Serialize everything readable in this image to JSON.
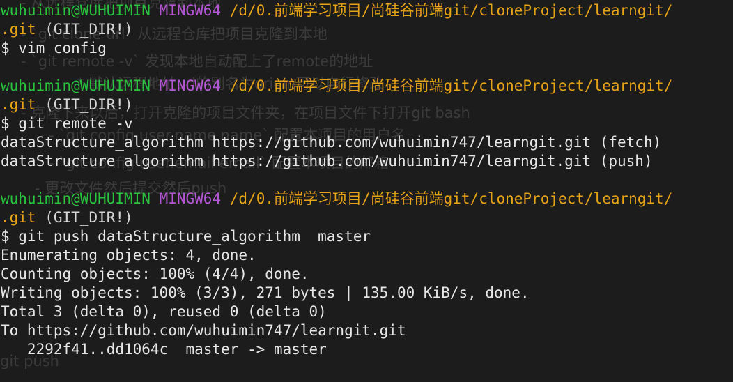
{
  "prompt": {
    "user": "wuhuimin@WUHUIMIN",
    "system": "MINGW64",
    "path": "/d/0.前端学习项目/尚硅谷前端git/cloneProject/learngit/",
    "path_cont": ".git",
    "git_dir": "(GIT_DIR!)"
  },
  "blocks": [
    {
      "command": "$ vim config",
      "output": []
    },
    {
      "command": "$ git remote -v",
      "output": [
        "dataStructure_algorithm https://github.com/wuhuimin747/learngit.git (fetch)",
        "dataStructure_algorithm https://github.com/wuhuimin747/learngit.git (push)"
      ]
    },
    {
      "command": "$ git push dataStructure_algorithm  master",
      "output": [
        "Enumerating objects: 4, done.",
        "Counting objects: 100% (4/4), done.",
        "Writing objects: 100% (3/3), 271 bytes | 135.00 KiB/s, done.",
        "Total 3 (delta 0), reused 0 (delta 0)",
        "To https://github.com/wuhuimin747/learngit.git",
        "   2292f41..dd1064c  master -> master"
      ]
    }
  ],
  "background_ghost_text": [
    "- 从远程仓库把项目克隆到本地",
    "- `git clone url` 从远程仓库把项目克隆到本地",
    "- `git remote -v` 发现本地自动配上了remote的地址",
    "* 默认远程地址url的别名为origin可以自行修改",
    "- 克隆下来以后，打开克隆的项目文件夹，在项目文件下打开git bash",
    "- `git config user.name name` 配置本项目的用户名",
    "- `git config user.email email` 配置本项目的邮箱",
    "- 更改文件然后提交然后push",
    "git push"
  ]
}
